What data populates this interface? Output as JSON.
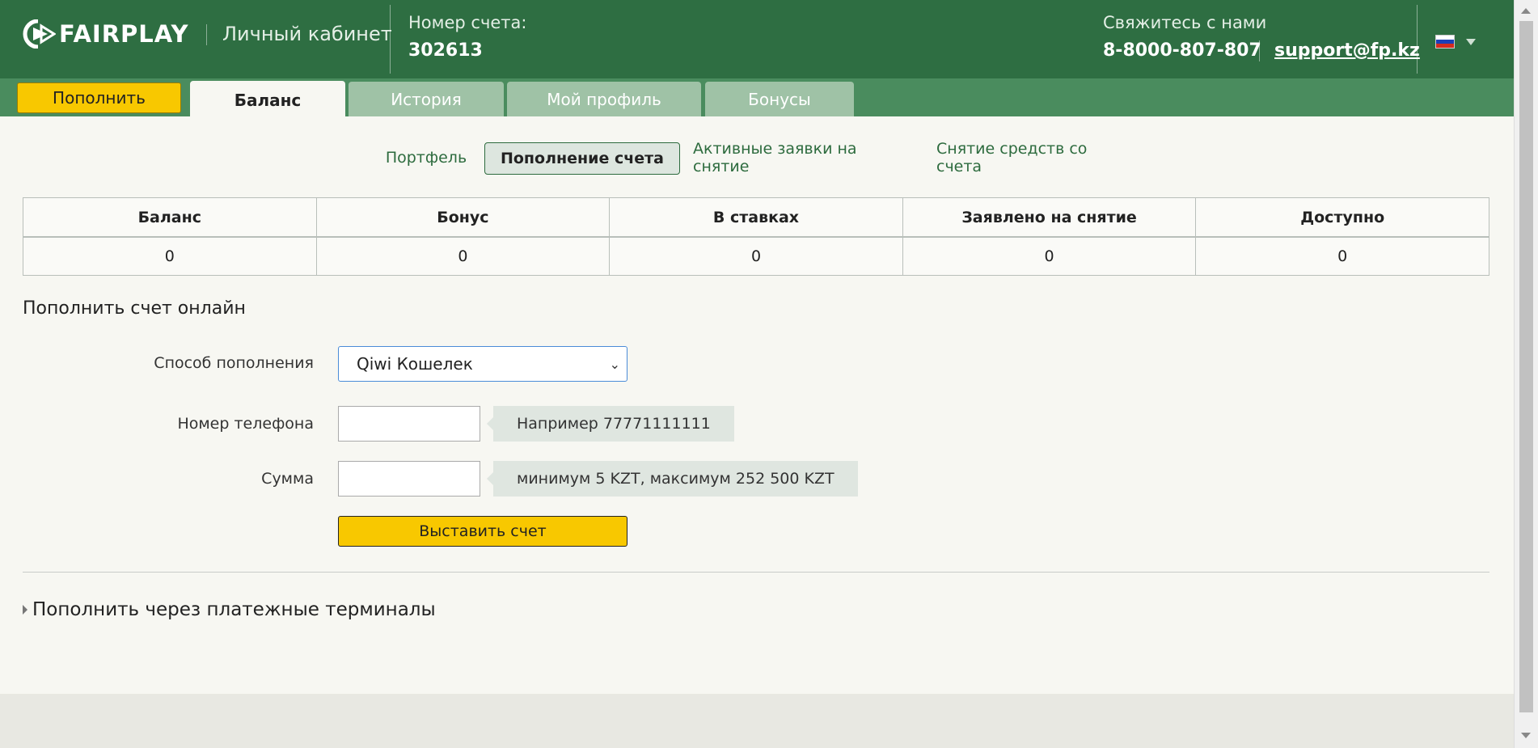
{
  "header": {
    "brand": "FAIRPLAY",
    "cabinet": "Личный кабинет",
    "account_label": "Номер счета:",
    "account_number": "302613",
    "contact_label": "Свяжитесь с нами",
    "phone": "8-8000-807-807",
    "email": "support@fp.kz",
    "language_flag": "flag-ru-icon"
  },
  "tabs": {
    "topup": "Пополнить",
    "items": [
      "Баланс",
      "История",
      "Мой профиль",
      "Бонусы"
    ],
    "active": "Баланс"
  },
  "subtabs": {
    "items": [
      "Портфель",
      "Пополнение счета",
      "Активные заявки на снятие",
      "Снятие средств со счета"
    ],
    "active": "Пополнение счета"
  },
  "summary": {
    "headers": [
      "Баланс",
      "Бонус",
      "В ставках",
      "Заявлено на снятие",
      "Доступно"
    ],
    "values": [
      "0",
      "0",
      "0",
      "0",
      "0"
    ]
  },
  "form": {
    "title": "Пополнить счет онлайн",
    "method_label": "Способ пополнения",
    "method_value": "Qiwi Кошелек",
    "phone_label": "Номер телефона",
    "phone_value": "",
    "phone_hint": "Например 77771111111",
    "amount_label": "Сумма",
    "amount_value": "",
    "amount_hint": "минимум 5 KZT,  максимум 252 500 KZT",
    "submit": "Выставить счет"
  },
  "terminals": {
    "label": "Пополнить через платежные терминалы"
  },
  "colors": {
    "header_green": "#2e6e42",
    "tabbar_green": "#4a8c5e",
    "accent_yellow": "#f8c800",
    "link_green": "#2d6b3e"
  }
}
